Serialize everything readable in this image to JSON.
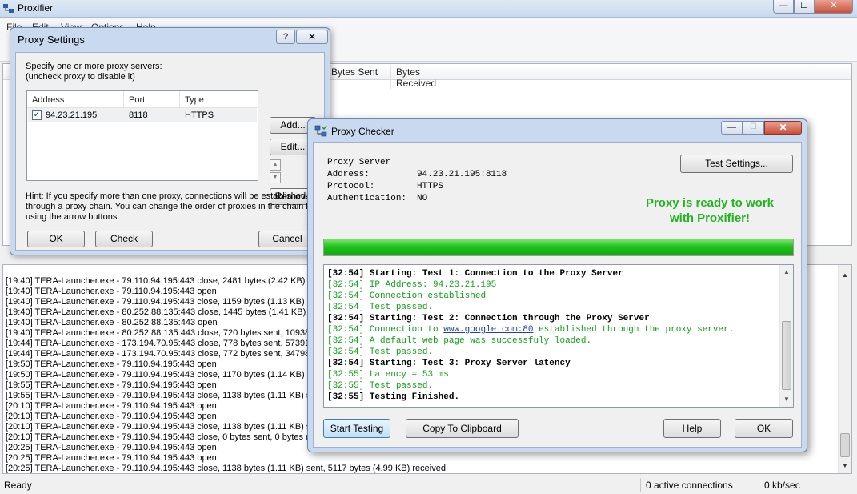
{
  "main": {
    "title": "Proxifier",
    "menu": [
      "File",
      "Edit",
      "View",
      "Options",
      "Help"
    ],
    "caption_buttons": {
      "minimize": "—",
      "maximize": "☐",
      "close": "✕"
    },
    "connections": {
      "columns": {
        "bytes_sent": "Bytes Sent",
        "bytes_received": "Bytes Received"
      }
    },
    "log": [
      "[19:40] TERA-Launcher.exe - 79.110.94.195:443 close, 2481 bytes (2.42 KB) se",
      "[19:40] TERA-Launcher.exe - 79.110.94.195:443 open",
      "[19:40] TERA-Launcher.exe - 79.110.94.195:443 close, 1159 bytes (1.13 KB) se",
      "[19:40] TERA-Launcher.exe - 80.252.88.135:443 close, 1445 bytes (1.41 KB) se",
      "[19:40] TERA-Launcher.exe - 80.252.88.135:443 open",
      "[19:40] TERA-Launcher.exe - 80.252.88.135:443 close, 720 bytes sent, 10938 b",
      "[19:44] TERA-Launcher.exe - 173.194.70.95:443 close, 778 bytes sent, 57391 b",
      "[19:44] TERA-Launcher.exe - 173.194.70.95:443 close, 772 bytes sent, 34798 b",
      "[19:50] TERA-Launcher.exe - 79.110.94.195:443 open",
      "[19:50] TERA-Launcher.exe - 79.110.94.195:443 close, 1170 bytes (1.14 KB) se",
      "[19:55] TERA-Launcher.exe - 79.110.94.195:443 open",
      "[19:55] TERA-Launcher.exe - 79.110.94.195:443 close, 1138 bytes (1.11 KB) se",
      "[20:10] TERA-Launcher.exe - 79.110.94.195:443 open",
      "[20:10] TERA-Launcher.exe - 79.110.94.195:443 open",
      "[20:10] TERA-Launcher.exe - 79.110.94.195:443 close, 1138 bytes (1.11 KB) se",
      "[20:10] TERA-Launcher.exe - 79.110.94.195:443 close, 0 bytes sent, 0 bytes re",
      "[20:25] TERA-Launcher.exe - 79.110.94.195:443 open",
      "[20:25] TERA-Launcher.exe - 79.110.94.195:443 open",
      "[20:25] TERA-Launcher.exe - 79.110.94.195:443 close, 1138 bytes (1.11 KB) sent, 5117 bytes (4.99 KB) received",
      "[20:25] TERA-Launcher.exe - 79.110.94.195:443 close, 0 bytes sent, 0 bytes received"
    ],
    "status": {
      "ready": "Ready",
      "connections": "0 active connections",
      "speed": "0 kb/sec"
    }
  },
  "settings": {
    "title": "Proxy Settings",
    "help_btn": "?",
    "close_btn": "✕",
    "intro_line1": "Specify one or more proxy servers:",
    "intro_line2": "(uncheck proxy to disable it)",
    "columns": {
      "address": "Address",
      "port": "Port",
      "type": "Type"
    },
    "proxy": {
      "checked": "✓",
      "address": "94.23.21.195",
      "port": "8118",
      "type": "HTTPS"
    },
    "buttons": {
      "add": "Add...",
      "edit": "Edit...",
      "remove": "Remove",
      "ok": "OK",
      "check": "Check",
      "cancel": "Cancel"
    },
    "arrow_up": "▲",
    "arrow_down": "▼",
    "hint_line1": "Hint: If you specify more than one proxy, connections will be established",
    "hint_line2": "through a proxy chain. You can change the order of proxies in the chain by",
    "hint_line3": "using the arrow buttons."
  },
  "checker": {
    "title": "Proxy Checker",
    "caption_buttons": {
      "minimize": "—",
      "maximize": "☐",
      "close": "✕"
    },
    "info": {
      "server": "Proxy Server",
      "address_label": "Address:",
      "address_value": "94.23.21.195:8118",
      "protocol_label": "Protocol:",
      "protocol_value": "HTTPS",
      "auth_label": "Authentication:",
      "auth_value": "NO"
    },
    "test_settings_btn": "Test Settings...",
    "ready_line1": "Proxy is ready to work",
    "ready_line2": "with Proxifier!",
    "progress": 1.0,
    "output": [
      {
        "time": "[32:54]",
        "text": "Starting: Test 1: Connection to the Proxy Server",
        "style": "black"
      },
      {
        "time": "[32:54]",
        "text": "IP Address: 94.23.21.195",
        "style": "green"
      },
      {
        "time": "[32:54]",
        "text": "Connection established",
        "style": "green"
      },
      {
        "time": "[32:54]",
        "text": "Test passed.",
        "style": "green"
      },
      {
        "time": "[32:54]",
        "text": "Starting: Test 2: Connection through the Proxy Server",
        "style": "black"
      },
      {
        "time": "[32:54]",
        "text": "Connection to ",
        "link": "www.google.com:80",
        "after": " established through the proxy server.",
        "style": "green"
      },
      {
        "time": "[32:54]",
        "text": "A default web page was successfuly loaded.",
        "style": "green"
      },
      {
        "time": "[32:54]",
        "text": "Test passed.",
        "style": "green"
      },
      {
        "time": "[32:54]",
        "text": "Starting: Test 3: Proxy Server latency",
        "style": "black"
      },
      {
        "time": "[32:55]",
        "text": "Latency = 53 ms",
        "style": "green"
      },
      {
        "time": "[32:55]",
        "text": "Test passed.",
        "style": "green"
      },
      {
        "time": "[32:55]",
        "text": "Testing Finished.",
        "style": "black"
      }
    ],
    "scroll_up": "▲",
    "scroll_down": "▼",
    "buttons": {
      "start": "Start Testing",
      "copy": "Copy To Clipboard",
      "help": "Help",
      "ok": "OK"
    }
  },
  "colors": {
    "accent_green": "#22b51f",
    "log_green": "#10a01a",
    "link_blue": "#1f3fb0"
  }
}
